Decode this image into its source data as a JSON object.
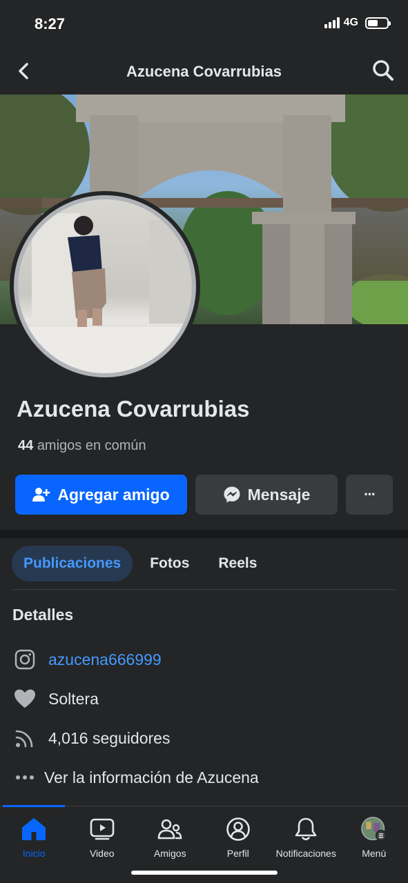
{
  "status_bar": {
    "time": "8:27",
    "network": "4G",
    "battery_level": 0.55
  },
  "header": {
    "title": "Azucena Covarrubias"
  },
  "profile": {
    "name": "Azucena Covarrubias",
    "mutual_count": "44",
    "mutual_text": "amigos en común"
  },
  "actions": {
    "add_friend": "Agregar amigo",
    "message": "Mensaje",
    "more": "···"
  },
  "tabs": [
    {
      "label": "Publicaciones",
      "active": true
    },
    {
      "label": "Fotos",
      "active": false
    },
    {
      "label": "Reels",
      "active": false
    }
  ],
  "details": {
    "title": "Detalles",
    "items": [
      {
        "icon": "instagram-icon",
        "text": "azucena666999",
        "link": true
      },
      {
        "icon": "heart-icon",
        "text": "Soltera",
        "link": false
      },
      {
        "icon": "rss-followers-icon",
        "text": "4,016 seguidores",
        "link": false
      },
      {
        "icon": "more-dots-icon",
        "text": "Ver la información de Azucena",
        "link": false
      }
    ]
  },
  "bottom_nav": [
    {
      "label": "Inicio",
      "icon": "home-icon",
      "active": true
    },
    {
      "label": "Video",
      "icon": "video-icon",
      "active": false
    },
    {
      "label": "Amigos",
      "icon": "friends-icon",
      "active": false
    },
    {
      "label": "Perfil",
      "icon": "profile-icon",
      "active": false
    },
    {
      "label": "Notificaciones",
      "icon": "bell-icon",
      "active": false
    },
    {
      "label": "Menú",
      "icon": "menu-avatar-icon",
      "active": false
    }
  ],
  "colors": {
    "accent": "#0866ff",
    "link": "#4599ff",
    "background": "#242526",
    "button": "#3a3b3c"
  }
}
